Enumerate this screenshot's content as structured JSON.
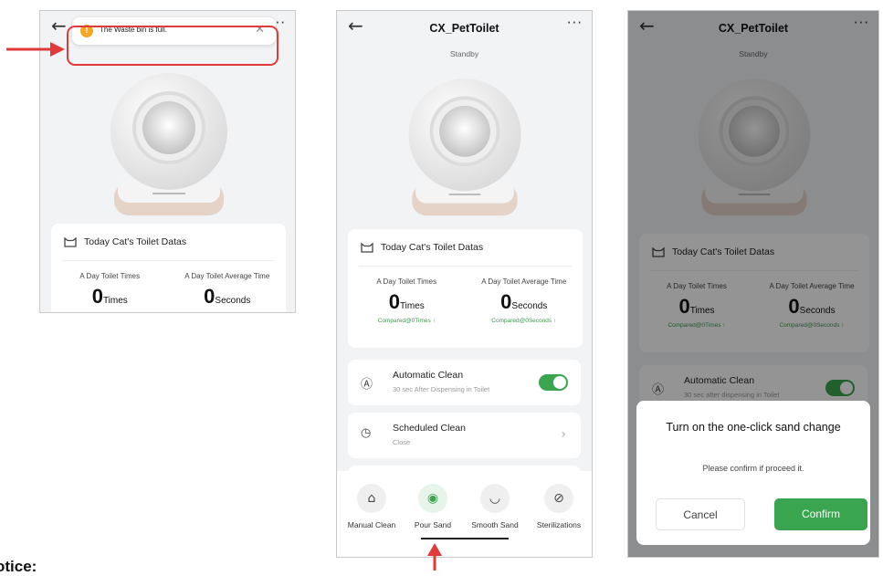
{
  "app": {
    "title": "CX_PetToilet",
    "status": "Standby",
    "back_icon": "←",
    "more_icon": "···"
  },
  "notification": {
    "text": "The Waste bin is full.",
    "icon": "!",
    "close_icon": "✕"
  },
  "stats": {
    "heading": "Today Cat's Toilet Datas",
    "times_label": "A Day Toilet Times",
    "times_value": "0",
    "times_unit": "Times",
    "times_compare": "Compared@0Times ↑",
    "avg_label": "A Day Toilet Average Time",
    "avg_value": "0",
    "avg_unit": "Seconds",
    "avg_compare": "Compared@0Seconds ↑"
  },
  "auto_clean": {
    "title": "Automatic Clean",
    "subtitle": "30 sec After Dispensing in Toilet",
    "subtitle_dimmed": "30 sec after dispensing in Toilet",
    "enabled": true
  },
  "scheduled_clean": {
    "title": "Scheduled Clean",
    "subtitle": "Close"
  },
  "actions": [
    {
      "label": "Manual Clean",
      "icon": "broom-icon",
      "glyph": "⌂"
    },
    {
      "label": "Pour Sand",
      "icon": "pour-sand-icon",
      "glyph": "◉"
    },
    {
      "label": "Smooth Sand",
      "icon": "smooth-sand-icon",
      "glyph": "◡"
    },
    {
      "label": "Sterilizations",
      "icon": "sterilization-icon",
      "glyph": "⊘"
    }
  ],
  "dialog": {
    "title": "Turn on the one-click sand change",
    "message": "Please confirm if proceed it.",
    "cancel_label": "Cancel",
    "confirm_label": "Confirm"
  },
  "notice_text": "otice:",
  "colors": {
    "accent_green": "#3aa54f",
    "warning_orange": "#f5a623",
    "annotation_red": "#e23a3a"
  }
}
